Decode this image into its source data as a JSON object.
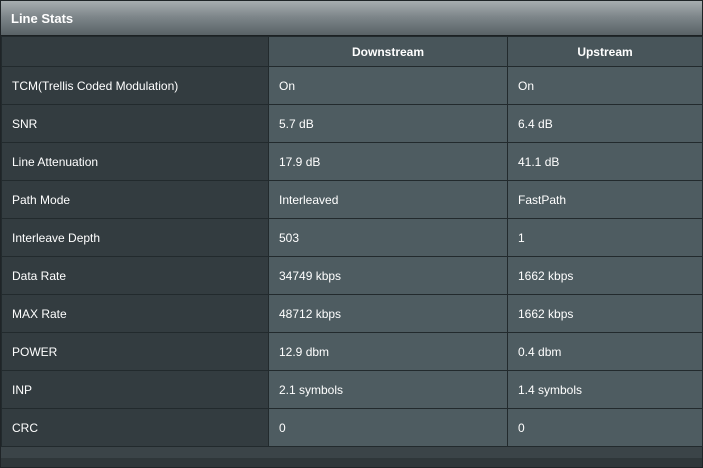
{
  "panel": {
    "title": "Line Stats"
  },
  "table": {
    "headers": [
      "",
      "Downstream",
      "Upstream"
    ],
    "rows": [
      {
        "label": "TCM(Trellis Coded Modulation)",
        "downstream": "On",
        "upstream": "On"
      },
      {
        "label": "SNR",
        "downstream": "5.7 dB",
        "upstream": "6.4 dB"
      },
      {
        "label": "Line Attenuation",
        "downstream": "17.9 dB",
        "upstream": "41.1 dB"
      },
      {
        "label": "Path Mode",
        "downstream": "Interleaved",
        "upstream": "FastPath"
      },
      {
        "label": "Interleave Depth",
        "downstream": "503",
        "upstream": "1"
      },
      {
        "label": "Data Rate",
        "downstream": "34749 kbps",
        "upstream": "1662 kbps"
      },
      {
        "label": "MAX Rate",
        "downstream": "48712 kbps",
        "upstream": "1662 kbps"
      },
      {
        "label": "POWER",
        "downstream": "12.9 dbm",
        "upstream": "0.4 dbm"
      },
      {
        "label": "INP",
        "downstream": "2.1 symbols",
        "upstream": "1.4 symbols"
      },
      {
        "label": "CRC",
        "downstream": "0",
        "upstream": "0"
      }
    ]
  },
  "colors": {
    "title_bar_top": "#a7adb0",
    "title_bar_bottom": "#596266",
    "label_cell_bg": "#333c40",
    "value_cell_bg": "#4e5c61",
    "header_bg": "#48555a",
    "text": "#ffffff"
  }
}
